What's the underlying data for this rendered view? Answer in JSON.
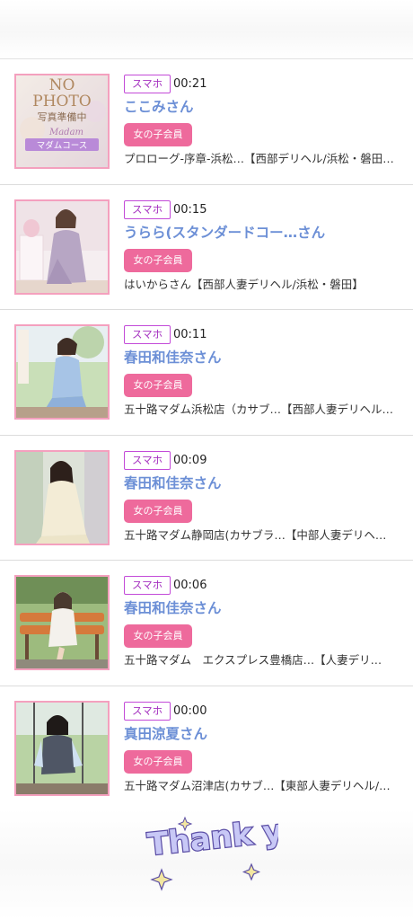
{
  "feed": [
    {
      "device": "スマホ",
      "elapsed": "00:21",
      "name": "ここみさん",
      "badge": "女の子会員",
      "shop": "プロローグ-序章-浜松…【西部デリヘル/浜松・磐田…",
      "photo": "no-photo-placeholder",
      "photo_text": {
        "line1": "NO",
        "line2": "PHOTO",
        "line3": "写真準備中",
        "script": "Madam",
        "course": "マダムコース"
      }
    },
    {
      "device": "スマホ",
      "elapsed": "00:15",
      "name": "うらら(スタンダードコー…さん",
      "badge": "女の子会員",
      "shop": "はいからさん【西部人妻デリヘル/浜松・磐田】",
      "photo": "profile-photo"
    },
    {
      "device": "スマホ",
      "elapsed": "00:11",
      "name": "春田和佳奈さん",
      "badge": "女の子会員",
      "shop": "五十路マダム浜松店（カサブ…【西部人妻デリヘル…",
      "photo": "profile-photo"
    },
    {
      "device": "スマホ",
      "elapsed": "00:09",
      "name": "春田和佳奈さん",
      "badge": "女の子会員",
      "shop": "五十路マダム静岡店(カサブラ…【中部人妻デリヘ…",
      "photo": "profile-photo"
    },
    {
      "device": "スマホ",
      "elapsed": "00:06",
      "name": "春田和佳奈さん",
      "badge": "女の子会員",
      "shop": "五十路マダム　エクスプレス豊橋店…【人妻デリ…",
      "photo": "profile-photo"
    },
    {
      "device": "スマホ",
      "elapsed": "00:00",
      "name": "真田涼夏さん",
      "badge": "女の子会員",
      "shop": "五十路マダム沼津店(カサブ…【東部人妻デリヘル/…",
      "photo": "profile-photo"
    }
  ],
  "footer": {
    "thankyou_text": "Thank you"
  },
  "colors": {
    "badge_pink": "#ee6a9c",
    "name_blue": "#6c8fd6",
    "device_purple": "#a532c0",
    "thumb_border": "#f4a0be"
  }
}
